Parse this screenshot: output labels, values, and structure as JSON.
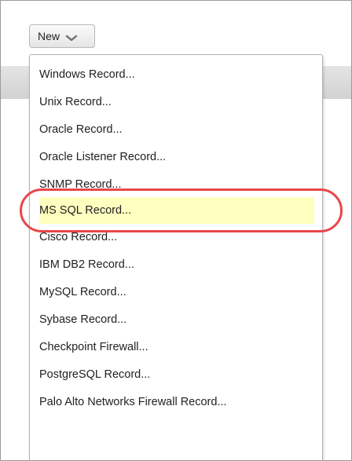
{
  "toolbar": {
    "new_button_label": "New"
  },
  "menu": {
    "items": [
      {
        "label": "Windows Record..."
      },
      {
        "label": "Unix Record..."
      },
      {
        "label": "Oracle Record..."
      },
      {
        "label": "Oracle Listener Record..."
      },
      {
        "label": "SNMP Record..."
      },
      {
        "label": "MS SQL Record...",
        "highlighted": true
      },
      {
        "label": "Cisco Record..."
      },
      {
        "label": "IBM DB2 Record..."
      },
      {
        "label": "MySQL Record..."
      },
      {
        "label": "Sybase Record..."
      },
      {
        "label": "Checkpoint Firewall..."
      },
      {
        "label": "PostgreSQL Record..."
      },
      {
        "label": "Palo Alto Networks Firewall Record..."
      }
    ]
  },
  "colors": {
    "highlight_fill": "#ffffbf",
    "highlight_ring": "#e8474a"
  }
}
